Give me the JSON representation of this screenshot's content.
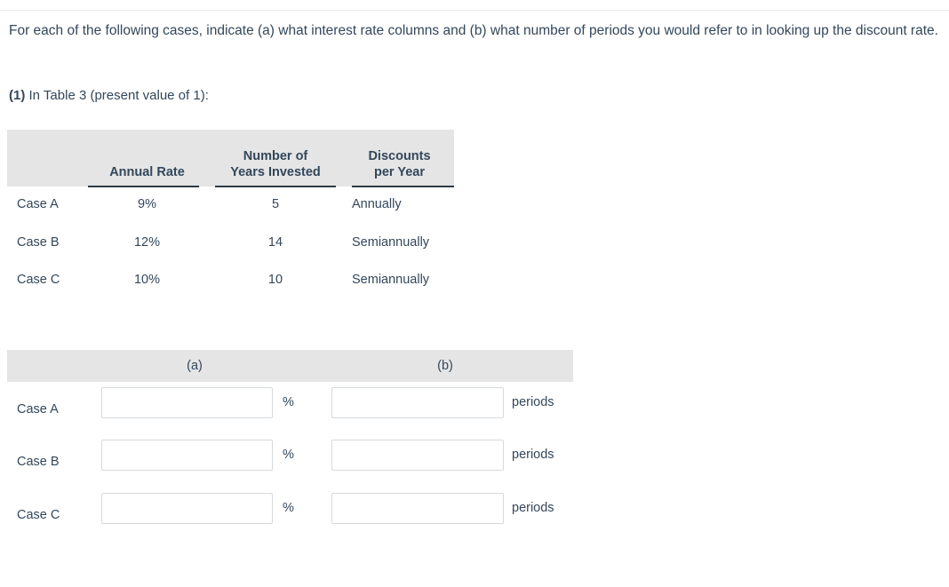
{
  "prompt": {
    "text": "For each of the following cases, indicate (a) what interest rate columns and (b) what number of periods you would refer to in looking up the discount rate."
  },
  "question": {
    "number": "(1)",
    "text": "In Table 3 (present value of 1):"
  },
  "given_table": {
    "headers": {
      "case": "",
      "annual_rate": "Annual Rate",
      "years_invested_line1": "Number of",
      "years_invested_line2": "Years Invested",
      "discounts_line1": "Discounts",
      "discounts_line2": "per Year"
    },
    "rows": [
      {
        "case": "Case A",
        "annual_rate": "9%",
        "years": "5",
        "discounts": "Annually"
      },
      {
        "case": "Case B",
        "annual_rate": "12%",
        "years": "14",
        "discounts": "Semiannually"
      },
      {
        "case": "Case C",
        "annual_rate": "10%",
        "years": "10",
        "discounts": "Semiannually"
      }
    ]
  },
  "answer_table": {
    "headers": {
      "col_a": "(a)",
      "col_b": "(b)"
    },
    "rows": [
      {
        "case": "Case A",
        "value_a": "",
        "unit_a": "%",
        "value_b": "",
        "unit_b": "periods"
      },
      {
        "case": "Case B",
        "value_a": "",
        "unit_a": "%",
        "value_b": "",
        "unit_b": "periods"
      },
      {
        "case": "Case C",
        "value_a": "",
        "unit_a": "%",
        "value_b": "",
        "unit_b": "periods"
      }
    ]
  },
  "colors": {
    "text": "#33475b",
    "header_band": "#e5e5e5",
    "input_border": "#d6d9dc",
    "rule": "#2f3b45"
  }
}
